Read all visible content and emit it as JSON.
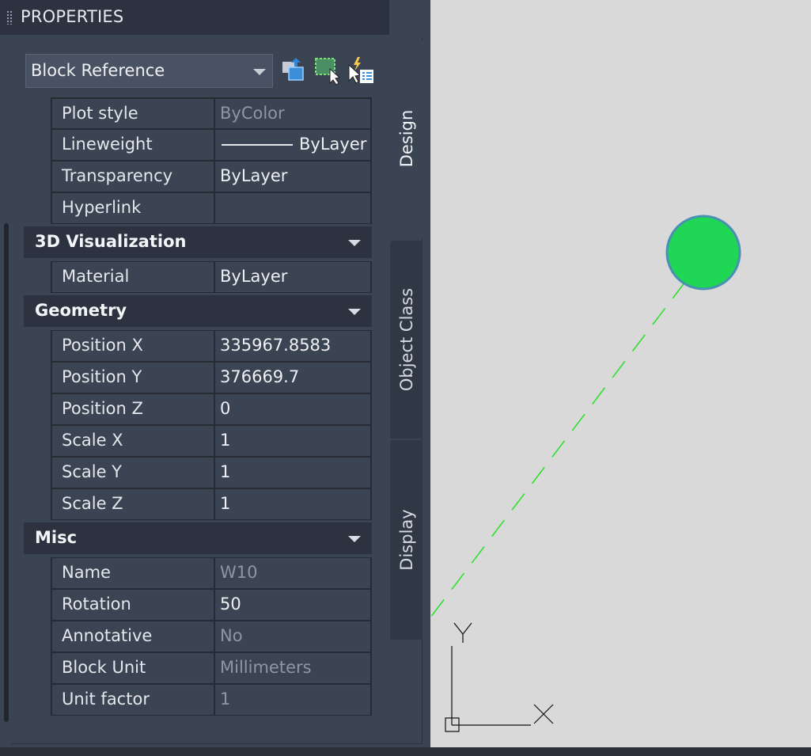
{
  "palette": {
    "title": "PROPERTIES",
    "selection": "Block Reference",
    "tools": [
      "quick-select-icon",
      "select-objects-icon",
      "toggle-pickadd-icon"
    ]
  },
  "sections": {
    "general_rows": [
      {
        "label": "Plot style",
        "value": "ByColor",
        "dim": true
      },
      {
        "label": "Lineweight",
        "value": "ByLayer",
        "dim": false,
        "lineweight": true
      },
      {
        "label": "Transparency",
        "value": "ByLayer",
        "dim": false
      },
      {
        "label": "Hyperlink",
        "value": "",
        "dim": false
      }
    ],
    "viz": {
      "name": "3D Visualization",
      "rows": [
        {
          "label": "Material",
          "value": "ByLayer",
          "dim": false
        }
      ]
    },
    "geometry": {
      "name": "Geometry",
      "rows": [
        {
          "label": "Position X",
          "value": "335967.8583",
          "dim": false
        },
        {
          "label": "Position Y",
          "value": "376669.7",
          "dim": false
        },
        {
          "label": "Position Z",
          "value": "0",
          "dim": false
        },
        {
          "label": "Scale X",
          "value": "1",
          "dim": false
        },
        {
          "label": "Scale Y",
          "value": "1",
          "dim": false
        },
        {
          "label": "Scale Z",
          "value": "1",
          "dim": false
        }
      ]
    },
    "misc": {
      "name": "Misc",
      "rows": [
        {
          "label": "Name",
          "value": "W10",
          "dim": true
        },
        {
          "label": "Rotation",
          "value": "50",
          "dim": false
        },
        {
          "label": "Annotative",
          "value": "No",
          "dim": true
        },
        {
          "label": "Block Unit",
          "value": "Millimeters",
          "dim": true
        },
        {
          "label": "Unit factor",
          "value": "1",
          "dim": true
        }
      ]
    }
  },
  "tabs": {
    "design": "Design",
    "object_class": "Object Class",
    "display": "Display"
  },
  "drawing": {
    "ucs_x": "X",
    "ucs_y": "Y",
    "circle_color": "#1fd655",
    "line_color": "#2ee02e"
  }
}
